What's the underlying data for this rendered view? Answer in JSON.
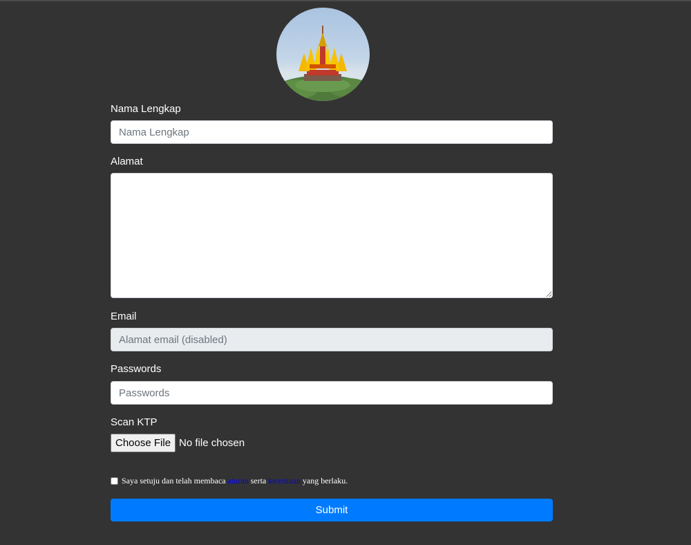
{
  "form": {
    "fullname": {
      "label": "Nama Lengkap",
      "placeholder": "Nama Lengkap"
    },
    "address": {
      "label": "Alamat"
    },
    "email": {
      "label": "Email",
      "placeholder": "Alamat email (disabled)"
    },
    "password": {
      "label": "Passwords",
      "placeholder": "Passwords"
    },
    "scan_ktp": {
      "label": "Scan KTP",
      "button": "Choose File",
      "status": "No file chosen"
    },
    "agreement": {
      "text_before": "Saya setuju dan telah membaca",
      "link1": "aturan",
      "text_middle": "serta",
      "link2": "ketentuan",
      "text_after": "yang berlaku."
    },
    "submit_label": "Submit"
  },
  "colors": {
    "background": "#333333",
    "submit": "#007bff",
    "disabled_field": "#e9ecef",
    "link": "#0000ee"
  },
  "icons": {
    "avatar": "monument-photo"
  }
}
